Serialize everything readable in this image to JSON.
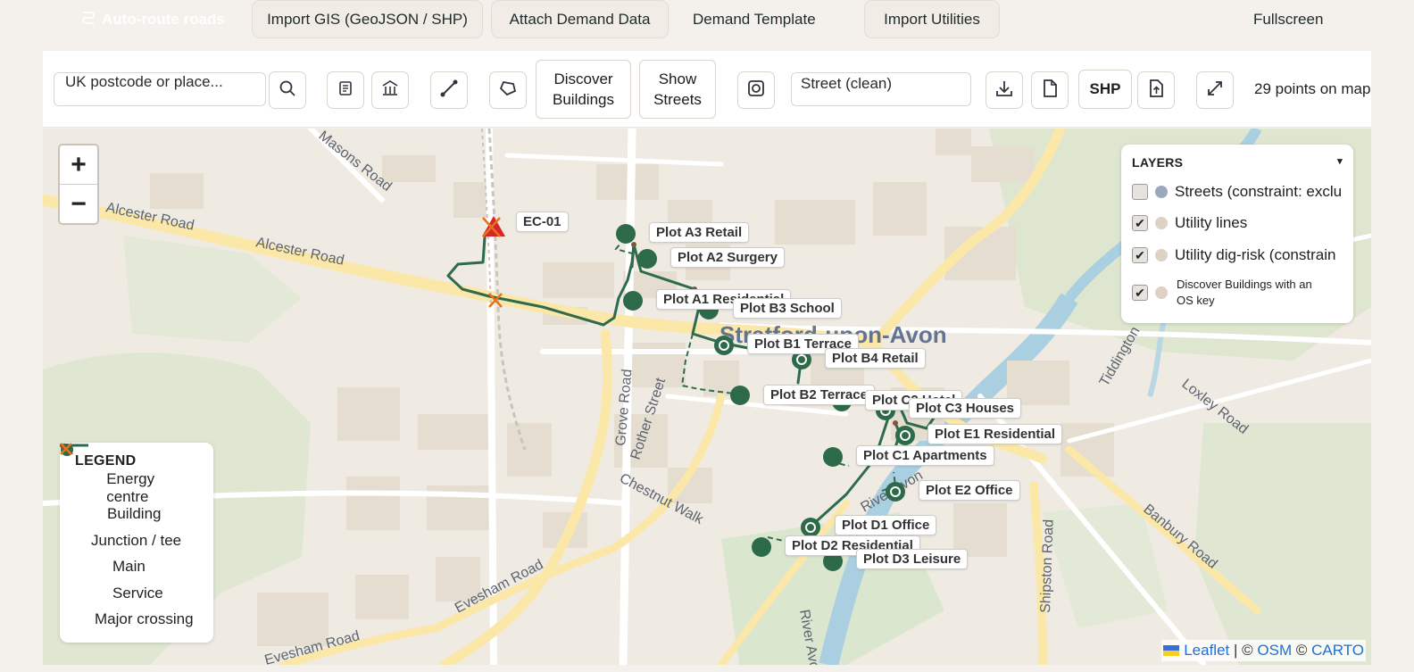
{
  "topbar": {
    "auto_route": "Auto-route roads",
    "import_gis": "Import GIS (GeoJSON / SHP)",
    "attach_demand": "Attach Demand Data",
    "demand_template": "Demand Template",
    "import_utilities": "Import Utilities",
    "fullscreen": "Fullscreen"
  },
  "toolbar": {
    "search_value": "UK postcode or place...",
    "discover_buildings_line1": "Discover",
    "discover_buildings_line2": "Buildings",
    "show_streets_line1": "Show",
    "show_streets_line2": "Streets",
    "street_style": "Street (clean)",
    "shp_label": "SHP",
    "points_status": "29 points on map"
  },
  "legend": {
    "title": "LEGEND",
    "items": [
      {
        "label": "Energy centre",
        "symbol": "triangle",
        "color": "#d62728"
      },
      {
        "label": "Building",
        "symbol": "circle",
        "color": "#2d6a4a"
      },
      {
        "label": "Junction / tee",
        "symbol": "small-circle",
        "color": "#7b5a3c"
      },
      {
        "label": "Main",
        "symbol": "solid-line",
        "color": "#2d6a4a"
      },
      {
        "label": "Service",
        "symbol": "dashed-line",
        "color": "#2d6a4a"
      },
      {
        "label": "Major crossing",
        "symbol": "cross",
        "color": "#e8731a"
      }
    ]
  },
  "layers": {
    "title": "LAYERS",
    "toggle": "▾",
    "items": [
      {
        "label": "Streets (constraint: exclu",
        "checked": false,
        "dot": "#9aa8bf"
      },
      {
        "label": "Utility lines",
        "checked": true,
        "dot": "#ddd2c4"
      },
      {
        "label": "Utility dig-risk (constrain",
        "checked": true,
        "dot": "#ddd2c4"
      },
      {
        "label_line1": "Discover Buildings with an",
        "label_line2": "OS key",
        "checked": true,
        "dot": "#ddd2c4"
      }
    ]
  },
  "map": {
    "zoom_in": "+",
    "zoom_out": "−",
    "town": "Stratford-upon-Avon",
    "roads": [
      "Alcester Road",
      "Alcester Road",
      "Masons Road",
      "Grove Road",
      "Rother Street",
      "Chestnut Walk",
      "Evesham Road",
      "Evesham Road",
      "Shipston Road",
      "Banbury Road",
      "Loxley Road",
      "Tiddington",
      "River Avon",
      "River Avon"
    ],
    "energy_centre": "EC-01",
    "plots": [
      "Plot A3 Retail",
      "Plot A2 Surgery",
      "Plot A1 Residential",
      "Plot B3 School",
      "Plot B1 Terrace",
      "Plot B4 Retail",
      "Plot B2 Terrace",
      "Plot C2 Hotel",
      "Plot C3 Houses",
      "Plot E1 Residential",
      "Plot C1 Apartments",
      "Plot E2 Office",
      "Plot D1 Office",
      "Plot D2 Residential",
      "Plot D3 Leisure"
    ]
  },
  "attribution": {
    "leaflet": "Leaflet",
    "sep1": " | © ",
    "osm": "OSM",
    "sep2": " © ",
    "carto": "CARTO"
  }
}
